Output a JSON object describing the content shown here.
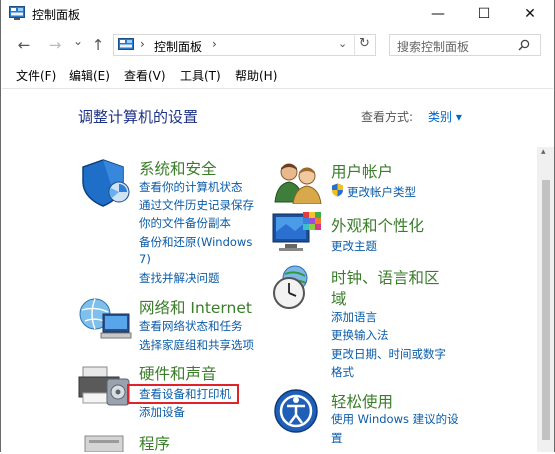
{
  "window": {
    "title": "控制面板",
    "controls": {
      "minimize": "—",
      "maximize": "☐",
      "close": "✕"
    }
  },
  "nav": {
    "back": "←",
    "forward": "→",
    "dropdown": "⌄",
    "up": "↑",
    "address": "控制面板",
    "address_sep": "›",
    "address_after": "›",
    "refresh": "↻",
    "search_placeholder": "搜索控制面板"
  },
  "menu": [
    "文件(F)",
    "编辑(E)",
    "查看(V)",
    "工具(T)",
    "帮助(H)"
  ],
  "main": {
    "heading": "调整计算机的设置",
    "view_by_label": "查看方式:",
    "view_by_value": "类别 ▾"
  },
  "categories_left": [
    {
      "title": "系统和安全",
      "icon": "shield-icon",
      "links": [
        "查看你的计算机状态",
        "通过文件历史记录保存",
        "你的文件备份副本",
        "备份和还原(Windows",
        "7)",
        "查找并解决问题"
      ]
    },
    {
      "title": "网络和 Internet",
      "icon": "network-icon",
      "links": [
        "查看网络状态和任务",
        "选择家庭组和共享选项"
      ]
    },
    {
      "title": "硬件和声音",
      "icon": "printer-icon",
      "links": [
        "查看设备和打印机",
        "添加设备"
      ]
    },
    {
      "title": "程序",
      "icon": "programs-icon",
      "links": []
    }
  ],
  "categories_right": [
    {
      "title": "用户帐户",
      "icon": "users-icon",
      "links": [
        "更改帐户类型"
      ]
    },
    {
      "title": "外观和个性化",
      "icon": "monitor-icon",
      "links": [
        "更改主题"
      ]
    },
    {
      "title_lines": [
        "时钟、语言和区",
        "域"
      ],
      "icon": "clock-icon",
      "links": [
        "添加语言",
        "更换输入法",
        "更改日期、时间或数字",
        "格式"
      ]
    },
    {
      "title": "轻松使用",
      "icon": "ease-of-access-icon",
      "links": [
        "使用 Windows 建议的设",
        "置"
      ]
    }
  ],
  "colors": {
    "category_title": "#3a7d2a",
    "link": "#0b5ca8",
    "heading": "#1e3287",
    "highlight": "#e0222a"
  }
}
